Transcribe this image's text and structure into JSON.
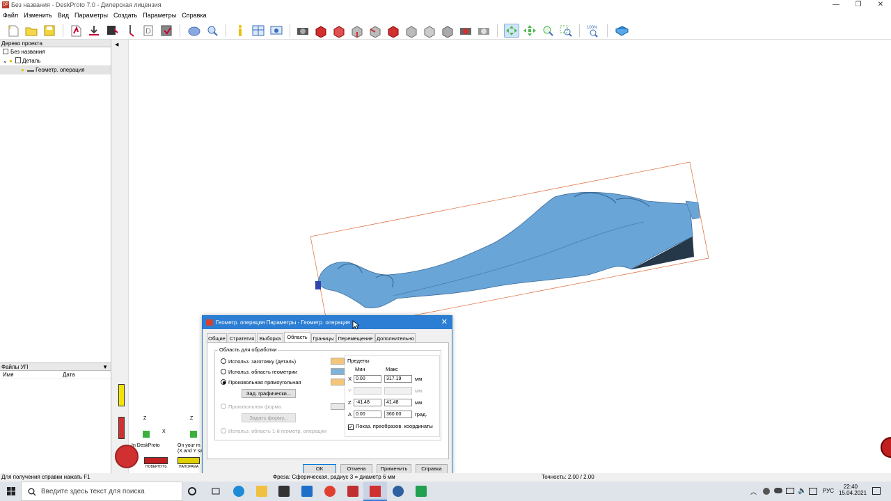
{
  "window": {
    "title": "Без названия - DeskProto 7.0 - Дилерская лицензия",
    "app_icon_text": "DP"
  },
  "menu": [
    "Файл",
    "Изменить",
    "Вид",
    "Параметры",
    "Создать",
    "Параметры",
    "Справка"
  ],
  "project_tree": {
    "header": "Дерево проекта",
    "root": "Без названия",
    "part": "Деталь",
    "operation": "Геометр. операция"
  },
  "files_panel": {
    "header": "Файлы УП",
    "col_name": "Имя",
    "col_date": "Дата"
  },
  "viewport": {
    "label_deskproto": "In DeskProto",
    "label_machine": "On your m",
    "label_machine2": "(X and Y sw",
    "axis_z": "Z",
    "axis_x": "X",
    "btn_rotate": "ПОВЕРНУТЬ",
    "btn_pan": "ПАНОРАМА"
  },
  "dialog": {
    "title": "Геометр. операция Параметры - Геометр. операция",
    "tabs": [
      "Общие",
      "Стратегия",
      "Выборка",
      "Область",
      "Границы",
      "Перемещение",
      "Дополнительно"
    ],
    "active_tab": "Область",
    "group_label": "Область для обработки",
    "options": [
      {
        "label": "Использ. заготовку (деталь)",
        "selected": false,
        "disabled": false
      },
      {
        "label": "Использ. область геометрии",
        "selected": false,
        "disabled": false
      },
      {
        "label": "Произвольная прямоугольная",
        "selected": true,
        "disabled": false
      },
      {
        "label": "Произвольная форма",
        "selected": false,
        "disabled": true
      },
      {
        "label": "Использ. область 1-й геометр. операции",
        "selected": false,
        "disabled": true
      }
    ],
    "btn_set_graphic": "Зад. графически...",
    "btn_set_shape": "Задать форму...",
    "limits": {
      "title": "Пределы",
      "min_label": "Мин",
      "max_label": "Макс",
      "rows": [
        {
          "axis": "X",
          "min": "0.00",
          "max": "317.19",
          "unit": "мм",
          "disabled": false
        },
        {
          "axis": "Y",
          "min": "",
          "max": "",
          "unit": "мм",
          "disabled": true
        },
        {
          "axis": "Z",
          "min": "-41.48",
          "max": "41.48",
          "unit": "мм",
          "disabled": false
        },
        {
          "axis": "A",
          "min": "0.00",
          "max": "360.00",
          "unit": "град.",
          "disabled": false
        }
      ],
      "show_transformed": {
        "label": "Показ. преобразов. координаты",
        "checked": true
      }
    },
    "buttons": {
      "ok": "ОК",
      "cancel": "Отмена",
      "apply": "Применить",
      "help": "Справка"
    }
  },
  "status": {
    "help": "Для получения справки нажать F1",
    "tool": "Фреза: Сферическая, радиус 3 = диаметр 6 мм",
    "accuracy": "Точность: 2.00 / 2.00"
  },
  "taskbar": {
    "search_placeholder": "Введите здесь текст для поиска",
    "lang": "РУС",
    "time": "22:40",
    "date": "15.04.2021"
  }
}
